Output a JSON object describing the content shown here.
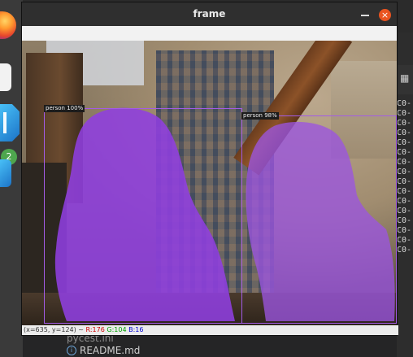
{
  "window": {
    "title": "frame",
    "close_glyph": "×"
  },
  "dock": {
    "badge_count": "2",
    "icons": [
      "firefox-icon",
      "files-icon",
      "vscode-icon",
      "vscode-icon"
    ]
  },
  "detections": [
    {
      "label": "person 100%",
      "mask_color": "#8f3fe0"
    },
    {
      "label": "person 98%",
      "mask_color": "#9b55e0"
    }
  ],
  "status": {
    "coords": "(x=635, y=124) ~",
    "r": "R:176",
    "g": "G:104",
    "b": "B:16"
  },
  "ide": {
    "co_lines": [
      "C0-",
      "C0-",
      "C0-",
      "C0-",
      "C0-",
      "C0-",
      "C0-",
      "C0-",
      "C0-",
      "C0-",
      "C0-",
      "C0-",
      "C0-",
      "C0-",
      "C0-",
      "C0-"
    ],
    "files": {
      "pycest": "pycest.ini",
      "readme": "README.md"
    }
  },
  "colors": {
    "accent_close": "#e95420",
    "bbox": "#a35be6"
  }
}
